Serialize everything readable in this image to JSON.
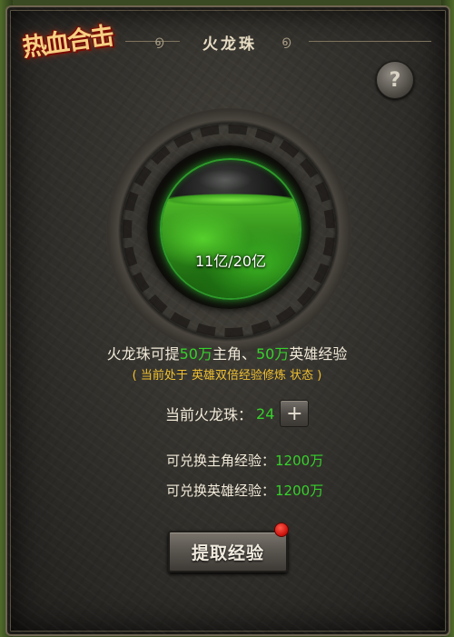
{
  "header": {
    "logo_text": "热血合击",
    "title": "火龙珠",
    "help_icon": "question-mark-icon",
    "help_label": "?"
  },
  "orb": {
    "progress_text": "11亿/20亿",
    "current": 11,
    "max": 20,
    "fill_color": "#36d12b"
  },
  "info": {
    "prefix": "火龙珠可提",
    "main_amount": "50万",
    "main_label": "主角、",
    "hero_amount": "50万",
    "hero_label": "英雄经验",
    "status_line": "( 当前处于 英雄双倍经验修炼 状态 )"
  },
  "current_pearls": {
    "label": "当前火龙珠：",
    "value": "24",
    "add_icon": "plus-icon",
    "add_label": "+"
  },
  "exchange": {
    "main_label": "可兑换主角经验：",
    "main_value": "1200万",
    "hero_label": "可兑换英雄经验：",
    "hero_value": "1200万"
  },
  "action": {
    "extract_label": "提取经验",
    "has_notification": true
  },
  "colors": {
    "accent_green": "#36d12b",
    "notice_yellow": "#f0c030",
    "notification_red": "#c80e0a"
  }
}
